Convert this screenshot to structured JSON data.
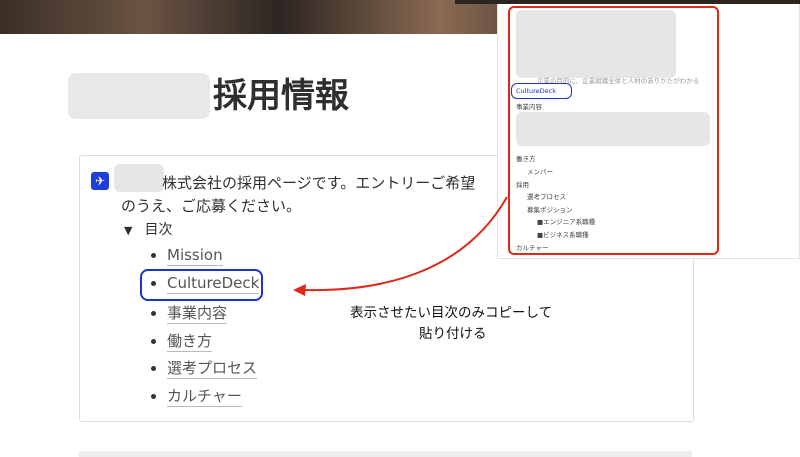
{
  "page": {
    "title": "採用情報",
    "intro_line1": "株式会社の採用ページです。エントリーご希望",
    "intro_line2": "のうえ、ご応募ください。",
    "toc_label": "目次",
    "toc_toggle_glyph": "▼",
    "toc_items": [
      "Mission",
      "CultureDeck",
      "事業内容",
      "働き方",
      "選考プロセス",
      "カルチャー"
    ]
  },
  "overlay": {
    "partial_line": "企業の目的に、企業組織全体と人材のありかたがわかる",
    "culturedeck": "CultureDeck",
    "jigyou": "事業内容",
    "hatarakikata": "働き方",
    "member": "メンバー",
    "saiyou": "採用",
    "senkou": "選考プロセス",
    "boshuu": "募集ポジション",
    "engineer": "■エンジニア系職種",
    "business": "■ビジネス系職種",
    "culture": "カルチャー"
  },
  "annotation": {
    "line1": "表示させたい目次のみコピーして",
    "line2": "貼り付ける"
  },
  "colors": {
    "highlight_blue": "#1a35c9",
    "highlight_red": "#e02818",
    "callout_icon": "#1e3fd8"
  },
  "icons": {
    "callout_icon": "plane-icon"
  }
}
